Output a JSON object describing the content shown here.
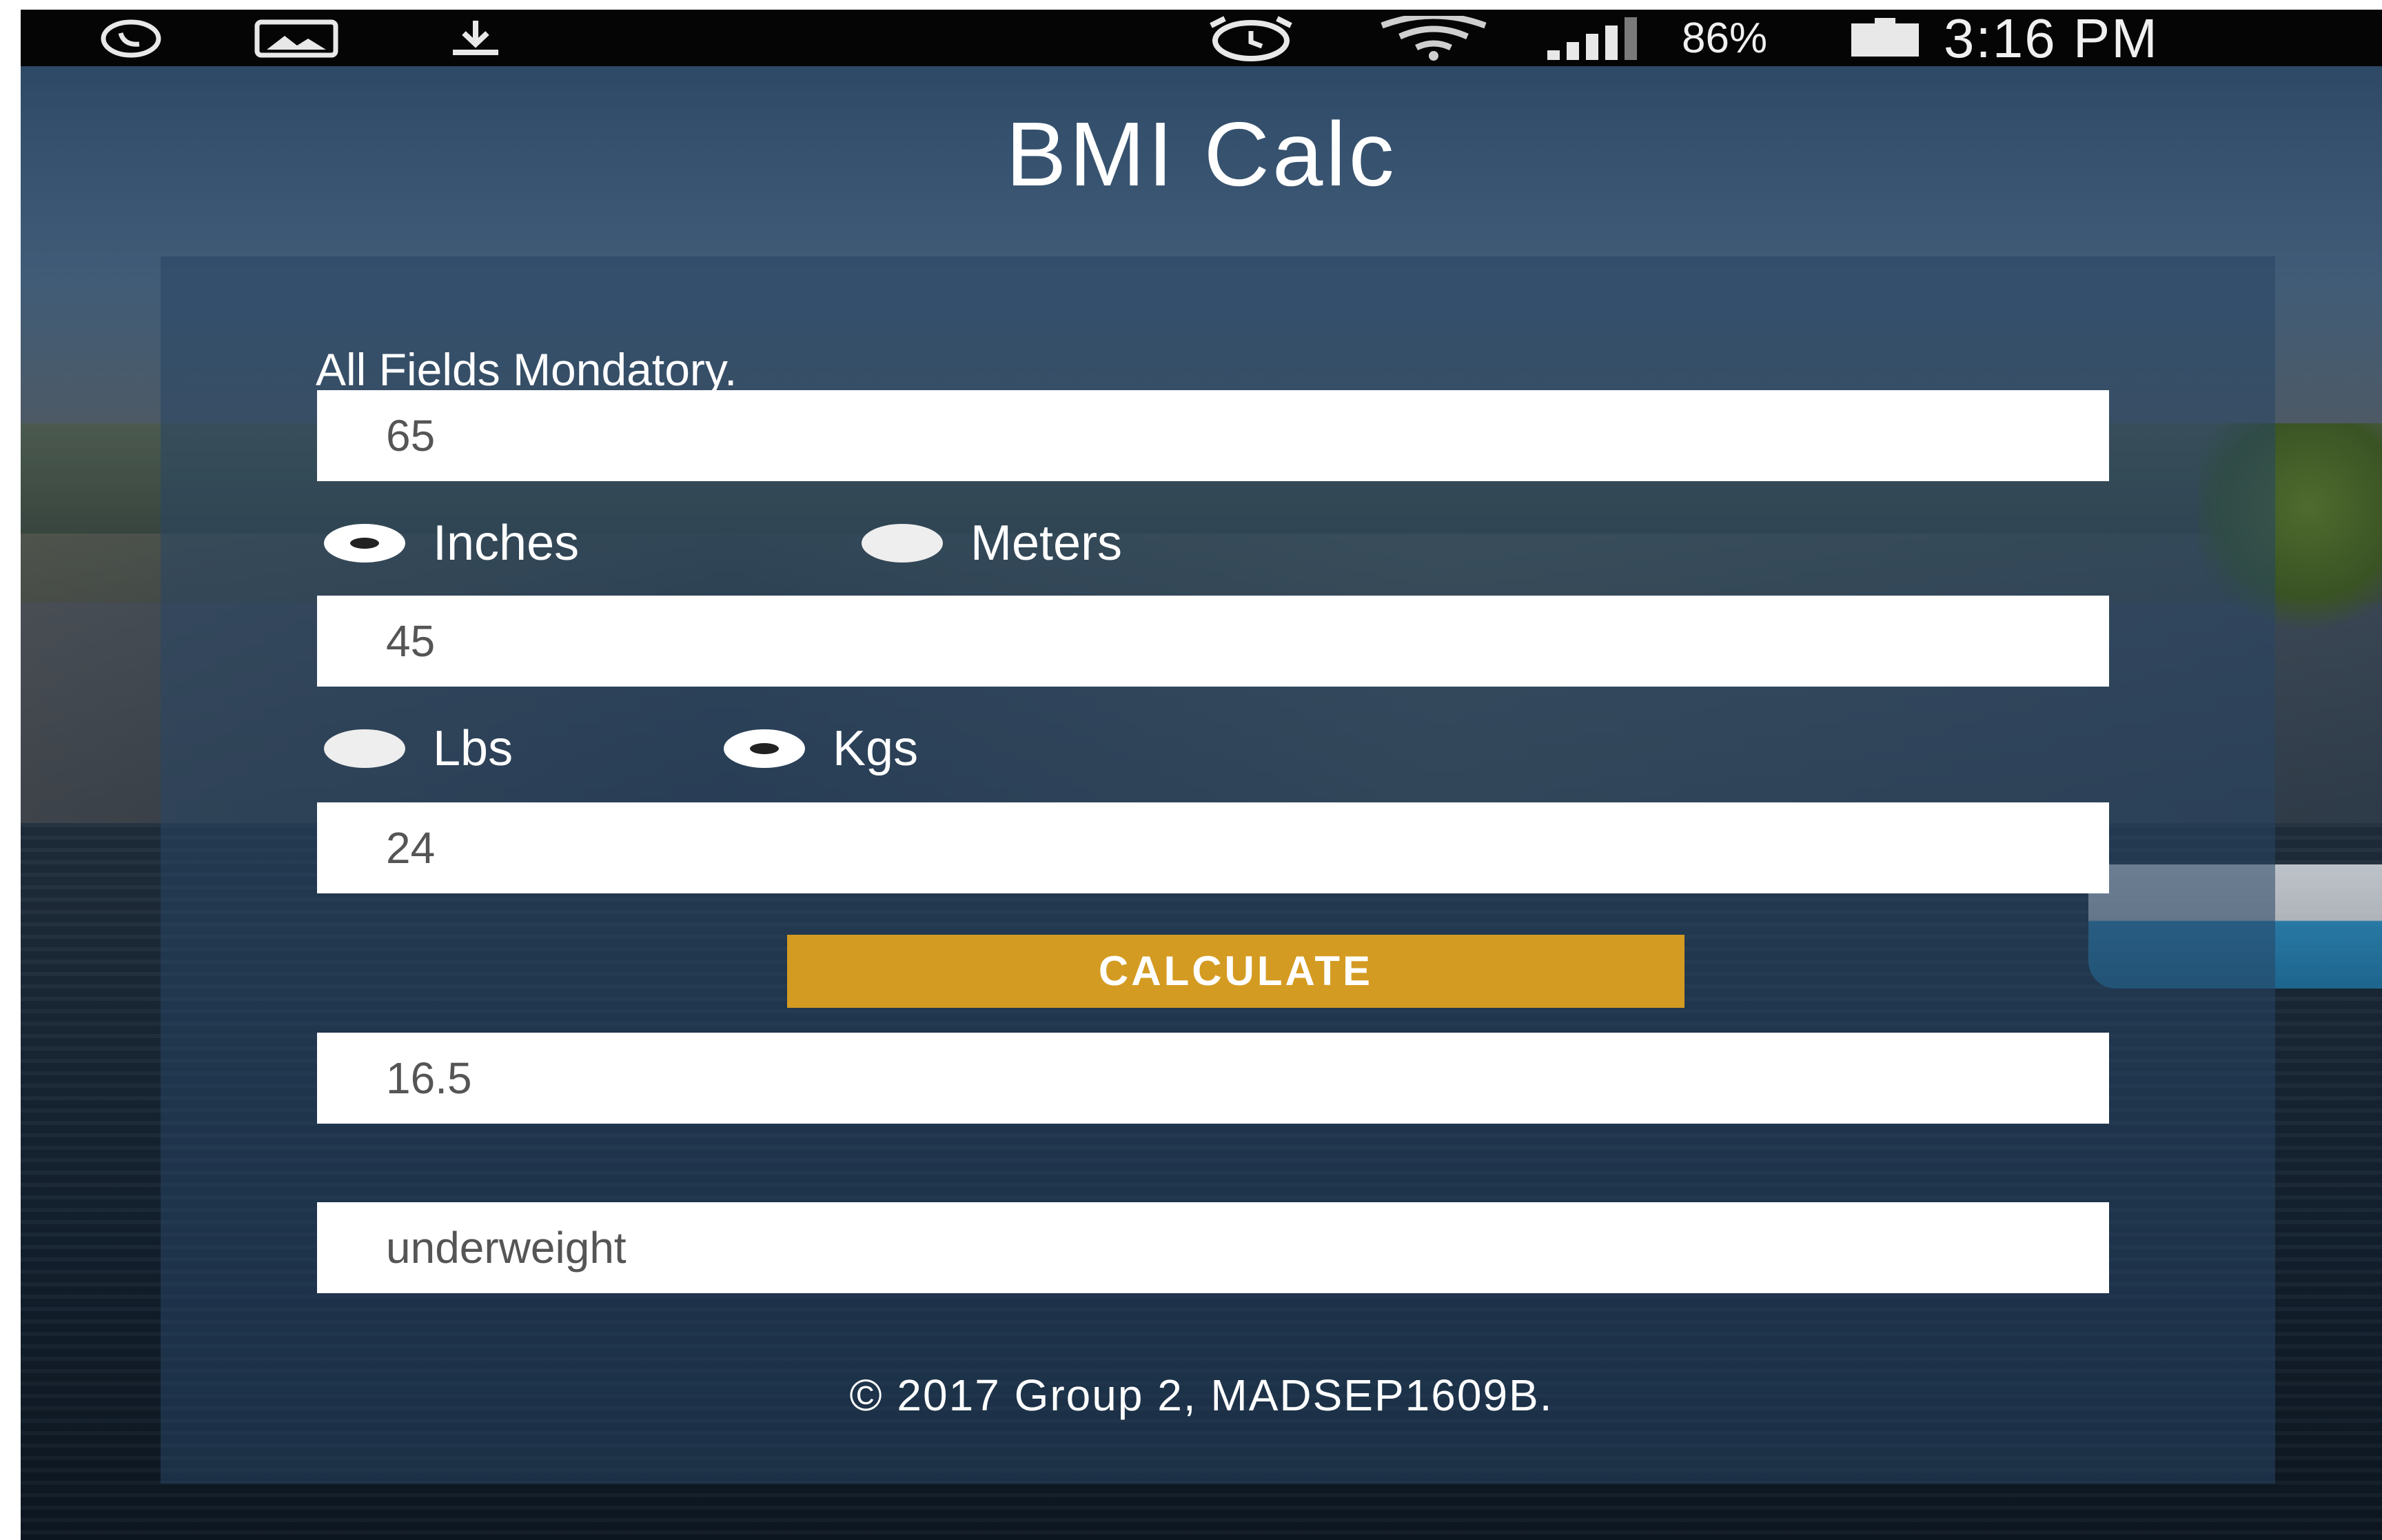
{
  "status_bar": {
    "battery_percent": "86%",
    "time": "3:16 PM",
    "left_icons": [
      "whatsapp-icon",
      "gallery-icon",
      "download-icon"
    ],
    "right_icons": [
      "alarm-icon",
      "wifi-icon",
      "signal-icon",
      "battery-icon"
    ]
  },
  "app": {
    "title": "BMI Calc"
  },
  "form": {
    "hint": "All Fields Mondatory.",
    "height_value": "65",
    "height_units": [
      {
        "label": "Inches",
        "checked": true
      },
      {
        "label": "Meters",
        "checked": false
      }
    ],
    "weight_value": "45",
    "weight_units": [
      {
        "label": "Lbs",
        "checked": false
      },
      {
        "label": "Kgs",
        "checked": true
      }
    ],
    "age_value": "24",
    "calculate_label": "CALCULATE",
    "bmi_result": "16.5",
    "category_result": "underweight"
  },
  "footer": {
    "text": "© 2017 Group 2, MADSEP1609B."
  },
  "colors": {
    "button": "#d49b22",
    "panel": "rgba(40,70,100,0.55)",
    "status_bar": "#050505"
  }
}
